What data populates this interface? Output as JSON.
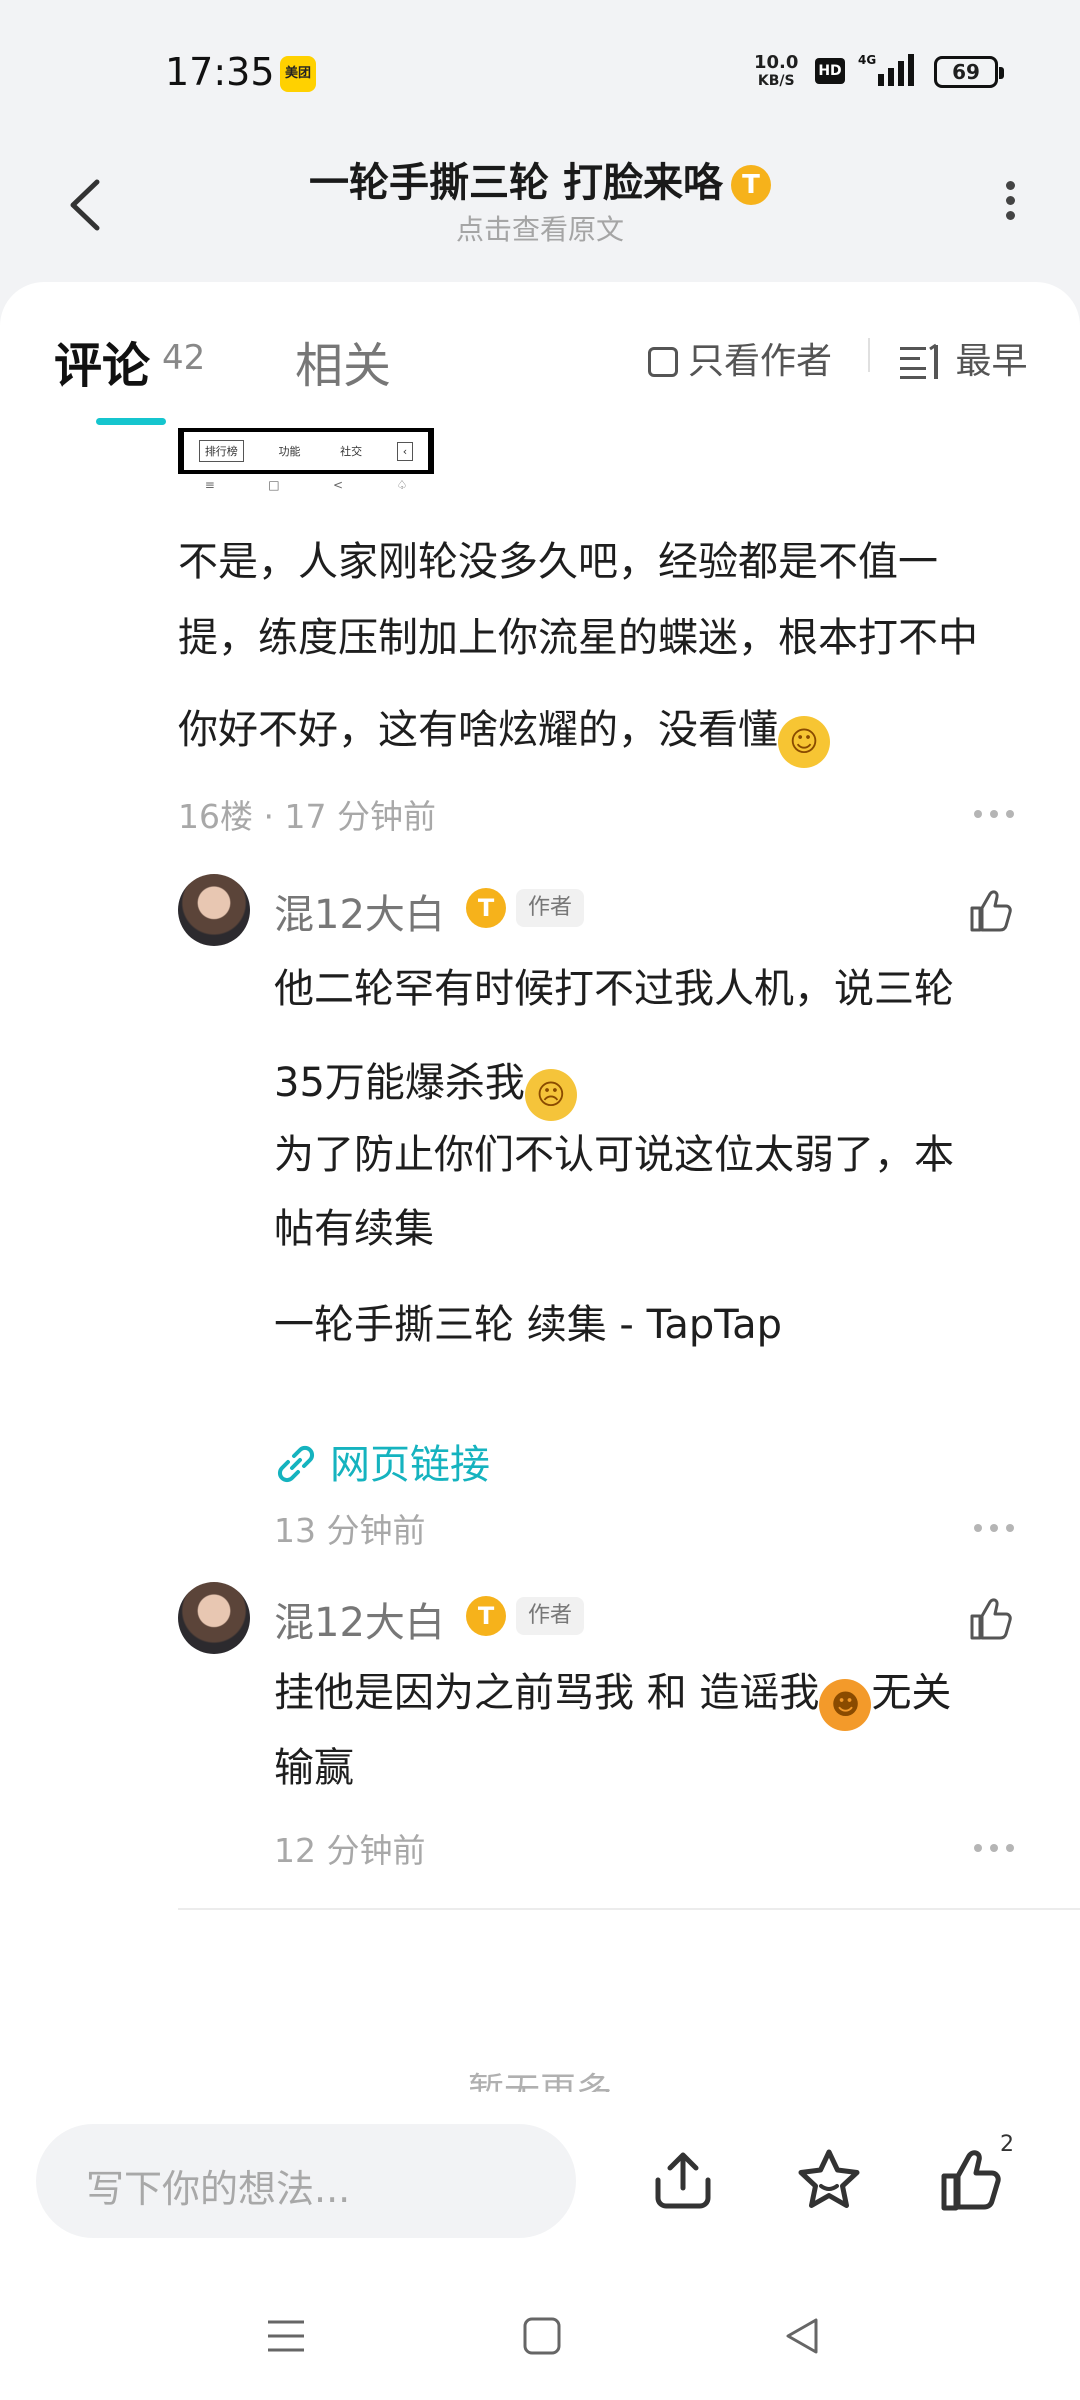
{
  "status_bar": {
    "time": "17:35",
    "app_badge": "美团",
    "net_speed_value": "10.0",
    "net_speed_unit": "KB/S",
    "hd": "HD",
    "network": "4G",
    "battery": "69"
  },
  "header": {
    "title": "一轮手撕三轮 打脸来咯",
    "subtitle": "点击查看原文",
    "badge_letter": "T"
  },
  "tabs": {
    "comment_label": "评论",
    "comment_count": "42",
    "related_label": "相关",
    "author_only_label": "只看作者",
    "sort_label": "最早"
  },
  "screenshot_strip": {
    "buttons": [
      "排行榜",
      "功能",
      "社交"
    ],
    "nav_glyphs": [
      "≡",
      "□",
      "<",
      "♤"
    ]
  },
  "main_comment": {
    "line1": "不是，人家刚轮没多久吧，经验都是不值一",
    "line2": "提，练度压制加上你流星的蝶迷，根本打不中",
    "line3": "你好不好，这有啥炫耀的，没看懂",
    "meta": "16楼 · 17 分钟前"
  },
  "replies": [
    {
      "username": "混12大白",
      "author_tag": "作者",
      "line1": "他二轮罕有时候打不过我人机，说三轮",
      "line2": "35万能爆杀我",
      "line3": "为了防止你们不认可说这位太弱了，本",
      "line4": "帖有续集",
      "line5": "一轮手撕三轮 续集 - TapTap",
      "link_label": "网页链接",
      "meta": "13 分钟前"
    },
    {
      "username": "混12大白",
      "author_tag": "作者",
      "line1_a": "挂他是因为之前骂我 和 造谣我",
      "line1_b": "无关",
      "line2": "输赢",
      "meta": "12 分钟前"
    }
  ],
  "no_more": "暂无更多",
  "bottom_bar": {
    "placeholder": "写下你的想法...",
    "like_count": "2"
  },
  "colors": {
    "accent": "#15c5ce",
    "link": "#15b3bf",
    "badge": "#f6b21b"
  },
  "icons": [
    "back-icon",
    "more-icon",
    "thumbs-up-icon",
    "share-icon",
    "star-icon",
    "link-icon",
    "menu-icon",
    "home-icon",
    "back-nav-icon"
  ]
}
